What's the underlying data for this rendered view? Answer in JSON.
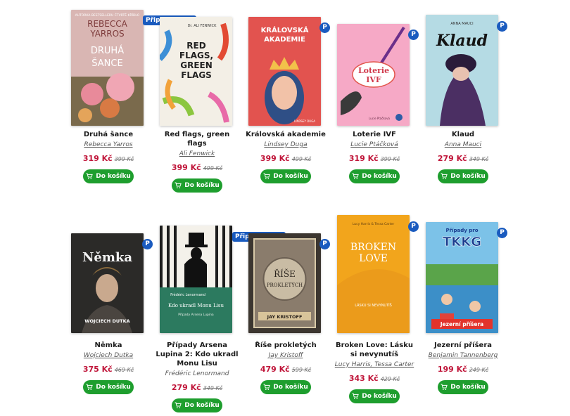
{
  "products": [
    {
      "title": "Druhá šance",
      "author": "Rebecca Yarros",
      "price": "319 Kč",
      "old_price": "399 Kč",
      "badge": "P",
      "tag": "",
      "cover_lines": [
        "AUTORKA BESTSELLERU ČTVRTÉ KŘÍDLO",
        "REBECCA",
        "YARROS",
        "DRUHÁ",
        "ŠANCE"
      ],
      "cover_color": "#d9b4b4"
    },
    {
      "title": "Red flags, green flags",
      "author": "Ali Fenwick",
      "price": "399 Kč",
      "old_price": "499 Kč",
      "badge": "",
      "tag": "Připravujeme",
      "cover_lines": [
        "Dr. ALI FENWICK",
        "RED",
        "FLAGS,",
        "GREEN",
        "FLAGS"
      ],
      "cover_color": "#f3efe6"
    },
    {
      "title": "Královská akademie",
      "author": "Lindsey Duga",
      "price": "399 Kč",
      "old_price": "499 Kč",
      "badge": "P",
      "tag": "",
      "cover_lines": [
        "KRÁLOVSKÁ",
        "AKADEMIE",
        "LINDSEY DUGA"
      ],
      "cover_color": "#e2534f"
    },
    {
      "title": "Loterie IVF",
      "author": "Lucie Ptáčková",
      "price": "319 Kč",
      "old_price": "399 Kč",
      "badge": "P",
      "tag": "",
      "cover_lines": [
        "Loterie",
        "IVF",
        "Lucie Ptáčková"
      ],
      "cover_color": "#f6a9c6"
    },
    {
      "title": "Klaud",
      "author": "Anna Mauci",
      "price": "279 Kč",
      "old_price": "349 Kč",
      "badge": "P",
      "tag": "",
      "cover_lines": [
        "ANNA MAUCI",
        "Klaud"
      ],
      "cover_color": "#b5dbe4"
    },
    {
      "title": "Němka",
      "author": "Wojciech Dutka",
      "price": "375 Kč",
      "old_price": "469 Kč",
      "badge": "P",
      "tag": "",
      "cover_lines": [
        "Němka",
        "WOJCIECH DUTKA"
      ],
      "cover_color": "#2b2a28"
    },
    {
      "title": "Případy Arsena Lupina 2: Kdo ukradl Monu Lisu",
      "author": "Frédéric Lenormand",
      "author_link": false,
      "price": "279 Kč",
      "old_price": "349 Kč",
      "badge": "",
      "tag": "Připravujeme",
      "cover_lines": [
        "Frédéric Lenormand",
        "Kdo ukradl Monu Lisu",
        "Případy Arsena Lupina"
      ],
      "cover_color": "#2c7a5f"
    },
    {
      "title": "Říše prokletých",
      "author": "Jay Kristoff",
      "price": "479 Kč",
      "old_price": "599 Kč",
      "badge": "P",
      "tag": "",
      "cover_lines": [
        "ŘÍŠE",
        "PROKLETÝCH",
        "JAY KRISTOFF"
      ],
      "cover_color": "#7a6e62"
    },
    {
      "title": "Broken Love: Lásku si nevynutíš",
      "author": "Lucy Harris, Tessa Carter",
      "price": "343 Kč",
      "old_price": "429 Kč",
      "badge": "P",
      "tag": "",
      "cover_lines": [
        "Lucy Harris & Tessa Carter",
        "BROKEN",
        "LOVE",
        "LÁSKU SI NEVYNUTÍŠ"
      ],
      "cover_color": "#f2a51c"
    },
    {
      "title": "Jezerní příšera",
      "author": "Benjamin Tannenberg",
      "price": "199 Kč",
      "old_price": "249 Kč",
      "badge": "P",
      "tag": "",
      "cover_lines": [
        "Případy pro",
        "TKKG",
        "Jezerní příšera"
      ],
      "cover_color": "#6fb6e0"
    }
  ],
  "buy_label": "Do košíku",
  "colors": {
    "price": "#c0163a",
    "button": "#1e9e2e",
    "badge": "#1a5bbf"
  },
  "icons": {
    "cart": "cart-icon"
  }
}
